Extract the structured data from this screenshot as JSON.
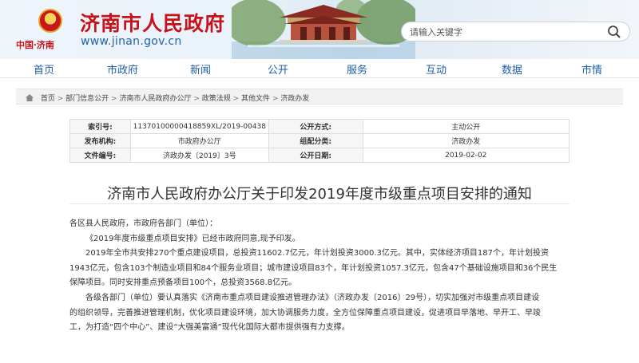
{
  "header": {
    "emblem_mark": "中国·济南",
    "title": "济南市人民政府",
    "url": "www.jinan.gov.cn"
  },
  "search": {
    "placeholder": "请输入关键字",
    "icon": "search-icon"
  },
  "nav": [
    "首页",
    "市政府",
    "新闻",
    "公开",
    "服务",
    "互动",
    "数据",
    "市情"
  ],
  "breadcrumb": [
    "首页",
    "部门信息公开",
    "济南市人民政府办公厅",
    "政策法规",
    "其他文件",
    "济政办发"
  ],
  "info": {
    "index_label": "索引号:",
    "index_value": "11370100000418859XL/2019-00438",
    "public_label": "公开方式:",
    "public_value": "主动公开",
    "issuer_label": "发布机构:",
    "issuer_value": "市政府办公厅",
    "category_label": "组配分类:",
    "category_value": "济政办发",
    "doc_no_label": "文件编号:",
    "doc_no_value": "济政办发〔2019〕3号",
    "date_label": "公开日期:",
    "date_value": "2019-02-02"
  },
  "document": {
    "title": "济南市人民政府办公厅关于印发2019年度市级重点项目安排的通知",
    "salutation": "各区县人民政府，市政府各部门（单位）：",
    "p1": "《2019年度市级重点项目安排》已经市政府同意,现予印发。",
    "p2_line1": "2019年全市共安排270个重点建设项目，总投资11602.7亿元，年计划投资3000.3亿元。其中，实体经济项目187个，年计划投资",
    "p2_line2": "1943亿元，包含103个制造业项目和84个服务业项目；城市建设项目83个，年计划投资1057.3亿元，包含47个基础设施项目和36个民生",
    "p2_line3": "保障项目。同时安排重点预备项目100个，总投资3568.8亿元。",
    "p3_line1": "各级各部门（单位）要认真落实《济南市重点项目建设推进管理办法》（济政办发〔2016〕29号），切实加强对市级重点项目建设",
    "p3_line2": "的组织领导，完善推进管理机制，优化项目建设环境，加大协调服务力度，全方位保障重点项目建设，促进项目早落地、早开工、早竣",
    "p3_line3": "工，为打造“四个中心”、建设“大强美富通”现代化国际大都市提供强有力支撑。"
  },
  "colors": {
    "brand_red": "#c8121a",
    "link_blue": "#1f5ea8"
  }
}
